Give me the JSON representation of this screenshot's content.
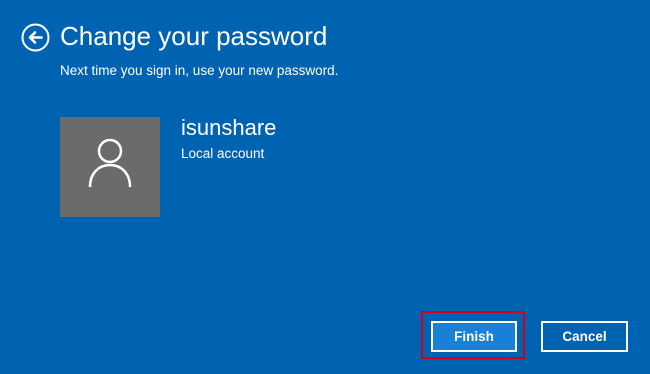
{
  "header": {
    "back_icon": "back-arrow-icon",
    "title": "Change your password",
    "subtitle": "Next time you sign in, use your new password."
  },
  "account": {
    "avatar_icon": "user-icon",
    "name": "isunshare",
    "type": "Local account"
  },
  "buttons": {
    "finish_label": "Finish",
    "cancel_label": "Cancel"
  },
  "colors": {
    "background": "#0063b1",
    "avatar_background": "#6b6b6b",
    "primary_button": "#1780d8",
    "highlight_border": "#d0021b",
    "text": "#ffffff"
  }
}
